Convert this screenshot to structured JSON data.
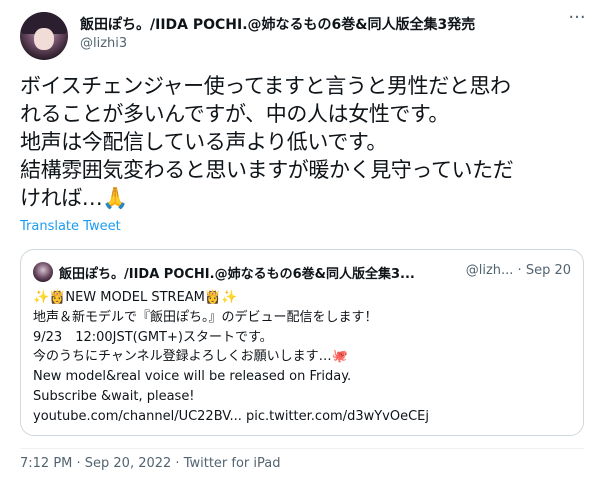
{
  "author": {
    "display_name": "飯田ぽち。/IIDA POCHI.@姉なるもの6巻&同人版全集3発売",
    "handle": "@lizhi3"
  },
  "more_icon": "more-horizontal-icon",
  "tweet": {
    "lines": [
      "ボイスチェンジャー使ってますと言うと男性だと思わ",
      "れることが多いんですが、中の人は女性です。",
      "地声は今配信している声より低いです。",
      "結構雰囲気変わると思いますが暖かく見守っていただ",
      "ければ…🙏"
    ],
    "translate_link": "Translate Tweet"
  },
  "quoted_tweet": {
    "display_name": "飯田ぽち。/IIDA POCHI.@姉なるもの6巻&同人版全集3...",
    "meta": "@lizh... · Sep 20",
    "lines": [
      "✨👸NEW MODEL STREAM👸✨",
      "地声＆新モデルで『飯田ぽち。』のデビュー配信をします！",
      "9/23　12:00JST(GMT+)スタートです。",
      "今のうちにチャンネル登録よろしくお願いします…🐙",
      "New model&real voice will be released on Friday.",
      "Subscribe &wait, please!",
      "youtube.com/channel/UC22BV... pic.twitter.com/d3wYvOeCEj"
    ]
  },
  "footer": {
    "timestamp": "7:12 PM · Sep 20, 2022 · Twitter for iPad"
  }
}
